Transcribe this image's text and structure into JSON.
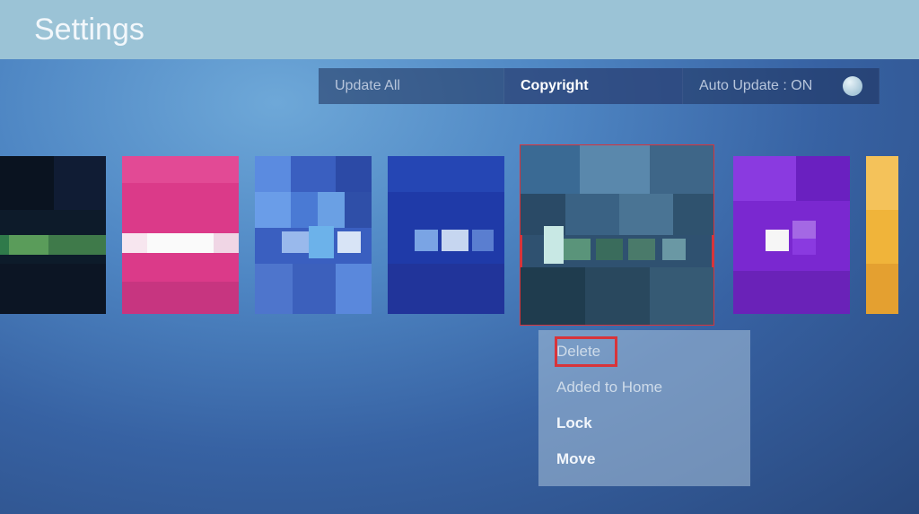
{
  "header": {
    "title": "Settings"
  },
  "tabs": {
    "update_all": {
      "label": "Update All"
    },
    "copyright": {
      "label": "Copyright"
    },
    "auto_update": {
      "label": "Auto Update : ON"
    }
  },
  "context_menu": {
    "delete": "Delete",
    "added_to_home": "Added to Home",
    "lock": "Lock",
    "move": "Move"
  }
}
